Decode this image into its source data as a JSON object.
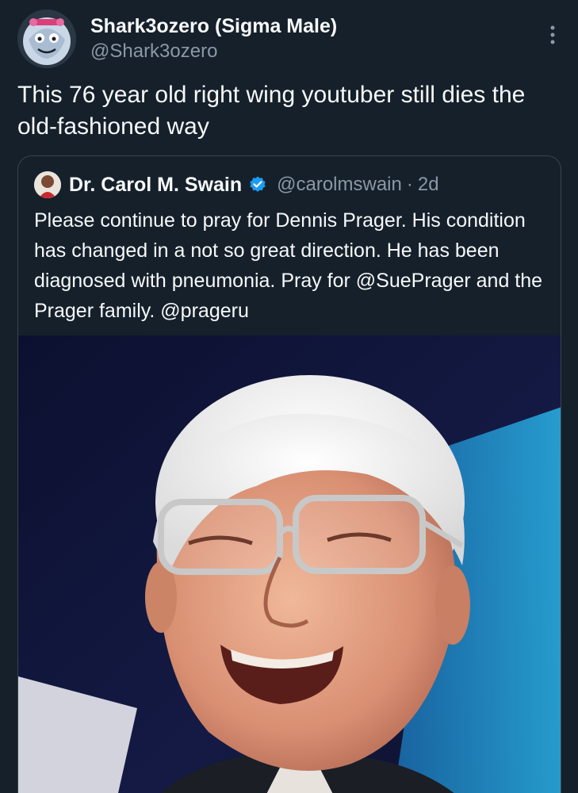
{
  "tweet": {
    "author": {
      "display_name": "Shark3ozero (Sigma Male)",
      "handle": "@Shark3ozero"
    },
    "text": "This 76 year old right wing youtuber still dies the old-fashioned way",
    "more_icon": "more-vertical-icon"
  },
  "quoted_tweet": {
    "author": {
      "display_name": "Dr. Carol M. Swain",
      "verified": true,
      "handle": "@carolmswain",
      "separator": "·",
      "time": "2d"
    },
    "text": "Please continue to pray for Dennis Prager. His condition has changed in a not so great direction. He has been diagnosed with pneumonia. Pray for @SuePrager and the Prager family. @prageru",
    "media": {
      "type": "photo"
    }
  },
  "colors": {
    "background": "#15202b",
    "text_primary": "#f7f9f9",
    "text_secondary": "#8b98a5",
    "border": "#38444d",
    "verified_blue": "#1d9bf0"
  }
}
